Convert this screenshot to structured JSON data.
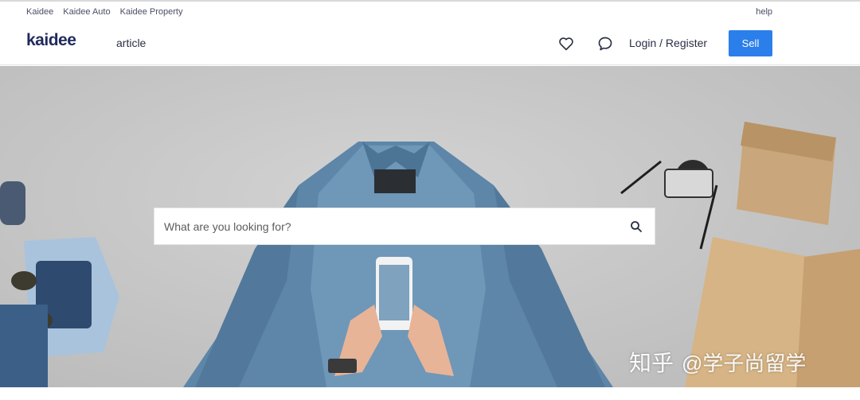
{
  "topbar": {
    "sites": [
      "Kaidee",
      "Kaidee Auto",
      "Kaidee Property"
    ],
    "help": "help"
  },
  "header": {
    "logo": "kaidee",
    "nav_article": "article",
    "login_register": "Login / Register",
    "sell": "Sell",
    "icons": [
      "heart-icon",
      "chat-bubble-icon"
    ]
  },
  "search": {
    "placeholder": "What are you looking for?",
    "value": "",
    "icon": "search-icon"
  },
  "watermark": {
    "logo": "知乎",
    "handle": "@学子尚留学"
  },
  "colors": {
    "accent": "#2b7fea",
    "logo": "#1f2a5c",
    "hero_bg": "#c7c7c7"
  }
}
